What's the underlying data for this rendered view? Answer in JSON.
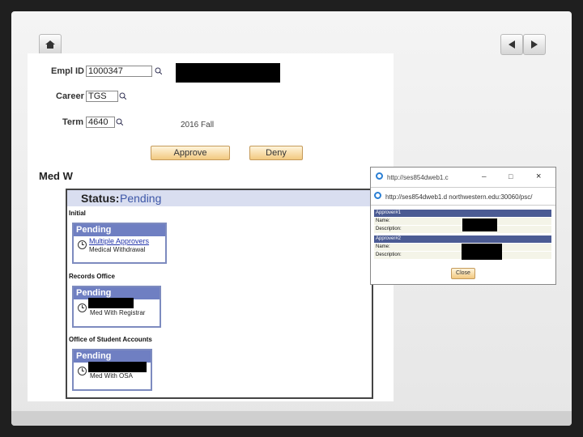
{
  "form": {
    "empl_id_label": "Empl ID",
    "empl_id_value": "1000347",
    "career_label": "Career",
    "career_value": "TGS",
    "term_label": "Term",
    "term_value": "4640",
    "term_desc": "2016 Fall",
    "approve_label": "Approve",
    "deny_label": "Deny"
  },
  "section_title": "Med W",
  "status": {
    "prefix": "Status:",
    "value": "Pending",
    "groups": [
      {
        "title": "Initial",
        "badge": "Pending",
        "link": "Multiple Approvers",
        "desc": "Medical Withdrawal"
      },
      {
        "title": "Records Office",
        "badge": "Pending",
        "desc": "Med With Registrar"
      },
      {
        "title": "Office of Student Accounts",
        "badge": "Pending",
        "desc": "Med With OSA"
      }
    ]
  },
  "popup": {
    "title_url": "http://ses854dweb1.c",
    "address_url": "http://ses854dweb1.d northwestern.edu:30060/psc/",
    "approver1_head": "Approver#1",
    "approver2_head": "Approver#2",
    "name_label": "Name:",
    "desc_label": "Description:",
    "close_label": "Close"
  },
  "colors": {
    "badge_blue": "#6f7fc2",
    "status_blue": "#3e58a8",
    "button_gold": "#f2c980"
  }
}
